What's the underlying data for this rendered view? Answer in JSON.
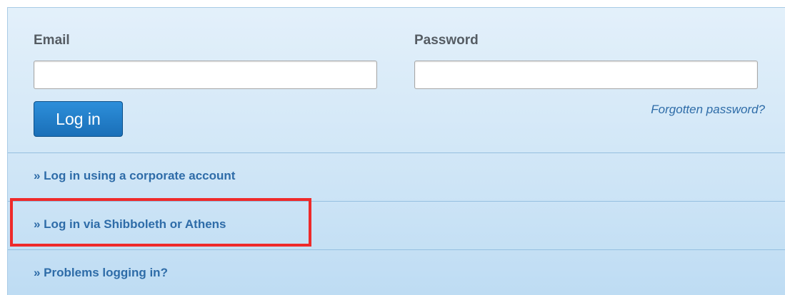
{
  "login_form": {
    "email_label": "Email",
    "email_value": "",
    "password_label": "Password",
    "password_value": "",
    "login_button_label": "Log in",
    "forgot_password_label": "Forgotten password?"
  },
  "alt_links": [
    {
      "label": "» Log in using a corporate account"
    },
    {
      "label": "» Log in via Shibboleth or Athens",
      "highlighted": true
    },
    {
      "label": "» Problems logging in?"
    }
  ],
  "colors": {
    "highlight": "#ee2a2a",
    "link": "#2e6ca8",
    "button": "#1a6fb8"
  }
}
